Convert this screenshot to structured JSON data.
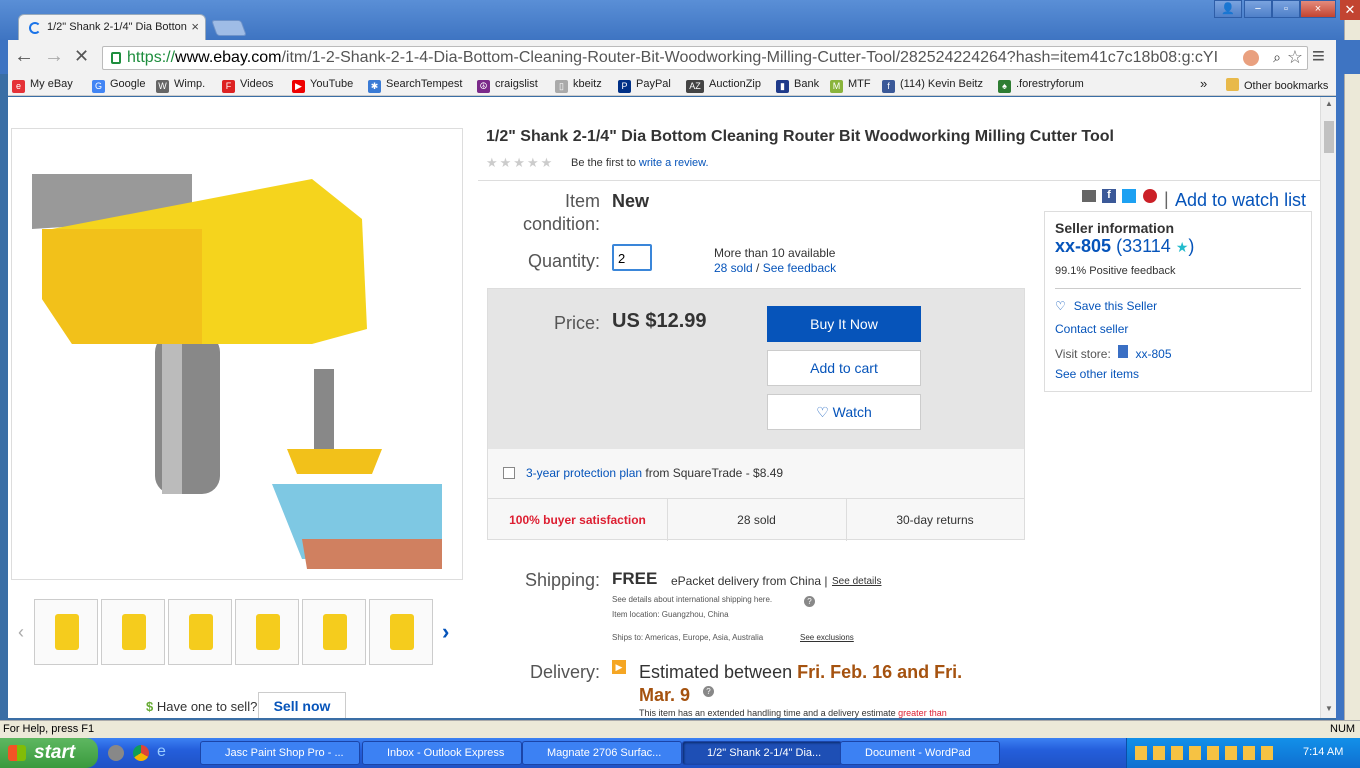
{
  "tab": {
    "title": "1/2\" Shank 2-1/4\" Dia Botton",
    "close": "×"
  },
  "window": {
    "min": "−",
    "restore": "▫",
    "close": "×",
    "extra_min": "▁",
    "extra_max": "❐",
    "extra_close": "✕"
  },
  "omnibox": {
    "scheme": "https://",
    "host": "www.ebay.com",
    "path": "/itm/1-2-Shank-2-1-4-Dia-Bottom-Cleaning-Router-Bit-Woodworking-Milling-Cutter-Tool/282524224264?hash=item41c7c18b08:g:cYI"
  },
  "nav": {
    "back": "←",
    "forward": "→",
    "stop": "✕",
    "menu": "≡",
    "star": "☆",
    "zoom": "🔍"
  },
  "bookmarks": [
    {
      "label": "My eBay",
      "color": "#e53238",
      "glyph": "e"
    },
    {
      "label": "Google",
      "color": "#4285f4",
      "glyph": "G"
    },
    {
      "label": "Wimp.",
      "color": "#666",
      "glyph": "W"
    },
    {
      "label": "Videos",
      "color": "#d22",
      "glyph": "F"
    },
    {
      "label": "YouTube",
      "color": "#e00",
      "glyph": "▶"
    },
    {
      "label": "SearchTempest",
      "color": "#3a7bd5",
      "glyph": "✱"
    },
    {
      "label": "craigslist",
      "color": "#7b2a8a",
      "glyph": "☮"
    },
    {
      "label": "kbeitz",
      "color": "#aaa",
      "glyph": "▯"
    },
    {
      "label": "PayPal",
      "color": "#003087",
      "glyph": "P"
    },
    {
      "label": "AuctionZip",
      "color": "#444",
      "glyph": "AZ"
    },
    {
      "label": "Bank",
      "color": "#1f3a8a",
      "glyph": "▮"
    },
    {
      "label": "MTF",
      "color": "#8ab43b",
      "glyph": "M"
    },
    {
      "label": "(114) Kevin Beitz",
      "color": "#3b5998",
      "glyph": "f"
    },
    {
      "label": ".forestryforum",
      "color": "#2e7d32",
      "glyph": "♠"
    }
  ],
  "bookmarks_more": "»",
  "other_bookmarks": "Other bookmarks",
  "product": {
    "title": "1/2\" Shank 2-1/4\" Dia Bottom Cleaning Router Bit Woodworking Milling Cutter Tool",
    "review_prefix": "Be the first to",
    "review_link": "write a review.",
    "stars": "★★★★★",
    "condition_label_1": "Item",
    "condition_label_2": "condition:",
    "condition": "New",
    "quantity_label": "Quantity:",
    "quantity": "2",
    "available": "More than 10 available",
    "sold_link": "28 sold",
    "sep": "/",
    "feedback_link": "See feedback",
    "price_label": "Price:",
    "price": "US $12.99",
    "buy_now": "Buy It Now",
    "add_cart": "Add to cart",
    "watch": "♡ Watch",
    "protection_link": "3-year protection plan",
    "protection_rest": "from SquareTrade - $8.49",
    "satisfaction": "100% buyer satisfaction",
    "sold_count": "28 sold",
    "returns": "30-day returns",
    "watch_list": "Add to watch list",
    "share_sep": "|",
    "shipping_label": "Shipping:",
    "shipping_free": "FREE",
    "shipping_method": "ePacket delivery from China |",
    "see_details": "See details",
    "intl_note": "See details about international shipping here.",
    "location": "Item location:  Guangzhou, China",
    "ships_to": "Ships to:  Americas, Europe, Asia, Australia",
    "exclusions": "See exclusions",
    "delivery_label": "Delivery:",
    "delivery_prefix": "Estimated between",
    "delivery_dates_1": "Fri. Feb. 16 and Fri.",
    "delivery_dates_2": "Mar. 9",
    "delivery_note": "This item has an extended handling time and a delivery estimate",
    "delivery_note_link": "greater than",
    "have_one": "Have one to sell?",
    "sell_now": "Sell now",
    "thumb_prev": "‹",
    "thumb_next": "›",
    "help_icon": "?"
  },
  "seller": {
    "heading": "Seller information",
    "name": "xx-805",
    "open": "(",
    "score": "33114",
    "star": "★",
    "close": ")",
    "positive": "99.1% Positive feedback",
    "save": "Save this Seller",
    "contact": "Contact seller",
    "visit_label": "Visit store:",
    "store": "xx-805",
    "other": "See other items"
  },
  "status": {
    "left": "For Help, press F1",
    "right": "NUM"
  },
  "taskbar": {
    "start": "start",
    "tasks": [
      "Jasc Paint Shop Pro - ...",
      "Inbox - Outlook Express",
      "Magnate 2706 Surfac...",
      "1/2\" Shank 2-1/4\" Dia...",
      "Document - WordPad"
    ],
    "clock": "7:14 AM"
  },
  "colors": {
    "ebay_blue": "#0654ba",
    "buy_btn": "#0654ba",
    "accent_red": "#dd1e31",
    "delivery_orange": "#a5520f"
  }
}
